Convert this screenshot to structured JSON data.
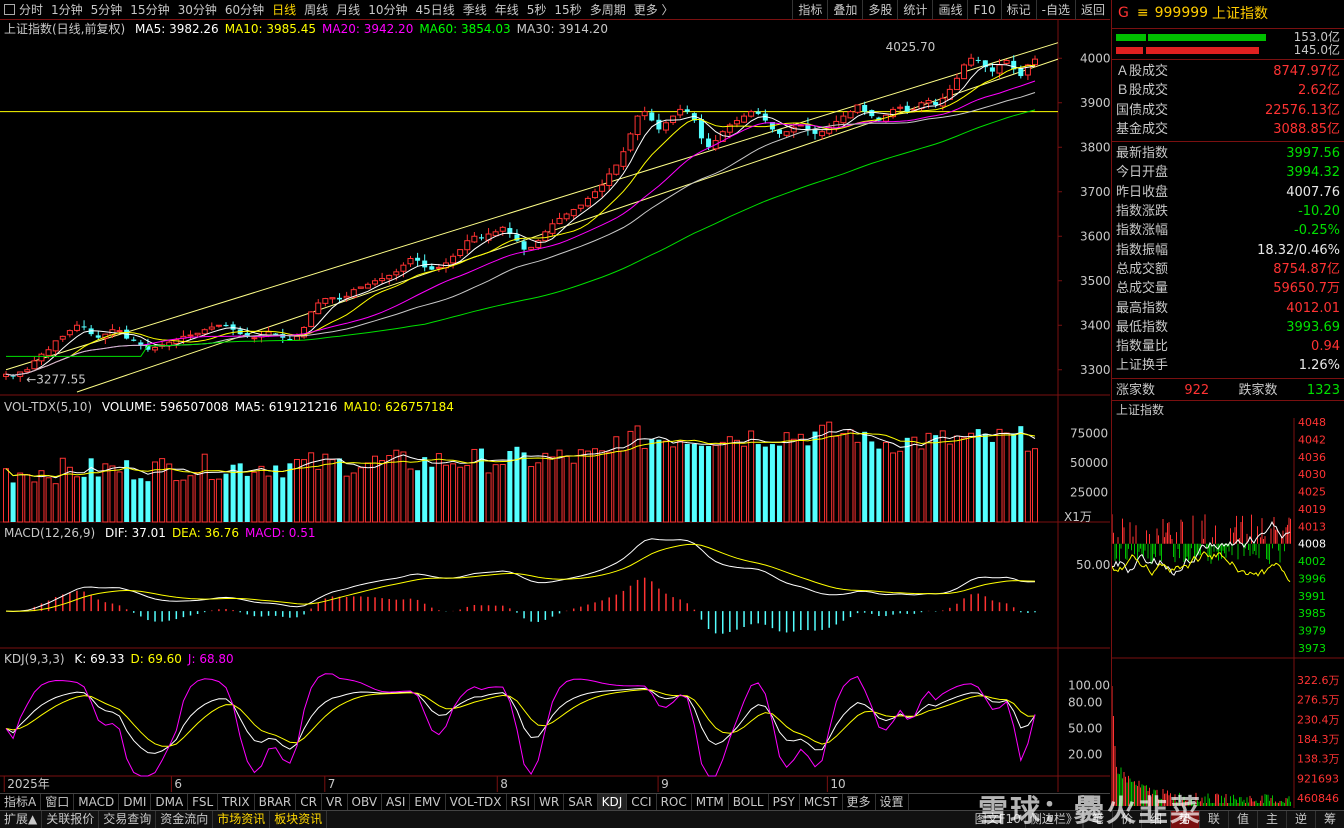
{
  "topbar": {
    "timeframes": [
      "分时",
      "1分钟",
      "5分钟",
      "15分钟",
      "30分钟",
      "60分钟",
      "日线",
      "周线",
      "月线",
      "10分钟",
      "45日线",
      "季线",
      "年线",
      "5秒",
      "15秒",
      "多周期",
      "更多 〉"
    ],
    "active": "日线",
    "buttons": [
      "指标",
      "叠加",
      "多股",
      "统计",
      "画线",
      "F10",
      "标记",
      "-自选",
      "返回"
    ]
  },
  "main": {
    "title": "上证指数(日线,前复权)",
    "ma": [
      {
        "label": "MA5: 3982.26",
        "color": "#ffffff"
      },
      {
        "label": "MA10: 3985.45",
        "color": "#ffff00"
      },
      {
        "label": "MA20: 3942.20",
        "color": "#ff00ff"
      },
      {
        "label": "MA60: 3854.03",
        "color": "#00ff00"
      },
      {
        "label": "MA30: 3914.20",
        "color": "#c8c8c8"
      }
    ],
    "high_label": "4025.70",
    "low_label": "3277.55",
    "y_ticks": [
      3300,
      3400,
      3500,
      3600,
      3700,
      3800,
      3900,
      4000
    ],
    "hline": 3880
  },
  "volume": {
    "title": "VOL-TDX(5,10)",
    "labels": [
      {
        "label": "VOLUME: 596507008",
        "color": "#ffffff"
      },
      {
        "label": "MA5: 619121216",
        "color": "#ffffff"
      },
      {
        "label": "MA10: 626757184",
        "color": "#ffff00"
      }
    ],
    "y_ticks": [
      25000,
      50000,
      75000
    ],
    "unit": "X1万"
  },
  "macd": {
    "title": "MACD(12,26,9)",
    "labels": [
      {
        "label": "DIF: 37.01",
        "color": "#ffffff"
      },
      {
        "label": "DEA: 36.76",
        "color": "#ffff00"
      },
      {
        "label": "MACD: 0.51",
        "color": "#ff00ff"
      }
    ],
    "y_tick": "50.00"
  },
  "kdj": {
    "title": "KDJ(9,3,3)",
    "labels": [
      {
        "label": "K: 69.33",
        "color": "#ffffff"
      },
      {
        "label": "D: 69.60",
        "color": "#ffff00"
      },
      {
        "label": "J: 68.80",
        "color": "#ff00ff"
      }
    ],
    "y_ticks": [
      "100.00",
      "80.00",
      "50.00",
      "20.00"
    ]
  },
  "x_axis": {
    "labels": [
      {
        "text": "2025年",
        "pos": 0.004
      },
      {
        "text": "6",
        "pos": 0.162
      },
      {
        "text": "7",
        "pos": 0.307
      },
      {
        "text": "8",
        "pos": 0.47
      },
      {
        "text": "9",
        "pos": 0.622
      },
      {
        "text": "10",
        "pos": 0.782
      }
    ]
  },
  "tabs": [
    "指标A",
    "窗口",
    "MACD",
    "DMI",
    "DMA",
    "FSL",
    "TRIX",
    "BRAR",
    "CR",
    "VR",
    "OBV",
    "ASI",
    "EMV",
    "VOL-TDX",
    "RSI",
    "WR",
    "SAR",
    "KDJ",
    "CCI",
    "ROC",
    "MTM",
    "BOLL",
    "PSY",
    "MCST",
    "更多",
    "设置"
  ],
  "active_tab": "KDJ",
  "bottom": {
    "left": [
      "扩展▲",
      "关联报价",
      "交易查询",
      "资金流向",
      "市场资讯",
      "板块资讯"
    ],
    "mid": [
      "图文F10",
      "侧边栏》"
    ],
    "right": [
      "笔",
      "价",
      "细",
      "势",
      "联",
      "值",
      "主",
      "逆",
      "筹"
    ],
    "active_right": "势"
  },
  "side": {
    "g": "G",
    "eq": "≡",
    "code": "999999",
    "name": "上证指数",
    "bars": [
      {
        "green_from": 0,
        "green_to": 0.13,
        "green2_from": 0.14,
        "green2_to": 0.66,
        "value": "153.0亿"
      },
      {
        "red_from": 0,
        "red_to": 0.12,
        "red2_from": 0.13,
        "red2_to": 0.63,
        "value": "145.0亿"
      }
    ],
    "turnover": [
      {
        "k": "Ａ股成交",
        "v": "8747.97亿",
        "c": "red"
      },
      {
        "k": "Ｂ股成交",
        "v": "2.62亿",
        "c": "red"
      },
      {
        "k": "国债成交",
        "v": "22576.13亿",
        "c": "red"
      },
      {
        "k": "基金成交",
        "v": "3088.85亿",
        "c": "red"
      }
    ],
    "stats": [
      {
        "k": "最新指数",
        "v": "3997.56",
        "c": "green"
      },
      {
        "k": "今日开盘",
        "v": "3994.32",
        "c": "green"
      },
      {
        "k": "昨日收盘",
        "v": "4007.76",
        "c": "white"
      },
      {
        "k": "指数涨跌",
        "v": "-10.20",
        "c": "green"
      },
      {
        "k": "指数涨幅",
        "v": "-0.25%",
        "c": "green"
      },
      {
        "k": "指数振幅",
        "v": "18.32/0.46%",
        "c": "white"
      },
      {
        "k": "总成交额",
        "v": "8754.87亿",
        "c": "red"
      },
      {
        "k": "总成交量",
        "v": "59650.7万",
        "c": "red"
      },
      {
        "k": "最高指数",
        "v": "4012.01",
        "c": "red"
      },
      {
        "k": "最低指数",
        "v": "3993.69",
        "c": "green"
      },
      {
        "k": "指数量比",
        "v": "0.94",
        "c": "red"
      },
      {
        "k": "上证换手",
        "v": "1.26%",
        "c": "white"
      }
    ],
    "updown": {
      "up_label": "涨家数",
      "up": "922",
      "down_label": "跌家数",
      "down": "1323"
    },
    "mini_title": "上证指数",
    "mini_price_ticks": [
      "4048",
      "4042",
      "4036",
      "4030",
      "4025",
      "4019",
      "4013",
      "4008",
      "4002",
      "3996",
      "3991",
      "3985",
      "3979",
      "3973"
    ],
    "mini_vol_ticks": [
      "322.6万",
      "276.5万",
      "230.4万",
      "184.3万",
      "138.3万",
      "921693",
      "460846"
    ]
  },
  "watermark": "雪球：爨火韭菜",
  "chart_data": {
    "type": "candlestick",
    "title": "上证指数(日线,前复权)",
    "price_range": [
      3277.55,
      4025.7
    ],
    "ylim": [
      3250,
      4050
    ],
    "closes": [
      3290,
      3285,
      3295,
      3300,
      3320,
      3335,
      3345,
      3365,
      3375,
      3388,
      3400,
      3395,
      3380,
      3372,
      3380,
      3390,
      3388,
      3370,
      3365,
      3355,
      3345,
      3350,
      3356,
      3362,
      3368,
      3375,
      3378,
      3382,
      3390,
      3396,
      3400,
      3398,
      3390,
      3380,
      3375,
      3372,
      3378,
      3385,
      3380,
      3372,
      3368,
      3375,
      3395,
      3430,
      3450,
      3460,
      3462,
      3458,
      3465,
      3480,
      3486,
      3492,
      3500,
      3505,
      3512,
      3520,
      3535,
      3550,
      3545,
      3530,
      3525,
      3530,
      3540,
      3555,
      3570,
      3590,
      3600,
      3595,
      3605,
      3610,
      3620,
      3605,
      3590,
      3570,
      3575,
      3590,
      3610,
      3628,
      3640,
      3650,
      3660,
      3670,
      3685,
      3700,
      3715,
      3740,
      3760,
      3790,
      3830,
      3870,
      3880,
      3860,
      3840,
      3855,
      3870,
      3885,
      3880,
      3860,
      3820,
      3800,
      3815,
      3835,
      3850,
      3860,
      3870,
      3880,
      3875,
      3860,
      3840,
      3830,
      3835,
      3845,
      3850,
      3838,
      3830,
      3835,
      3845,
      3858,
      3870,
      3880,
      3895,
      3880,
      3870,
      3860,
      3872,
      3885,
      3890,
      3880,
      3885,
      3900,
      3905,
      3895,
      3910,
      3930,
      3955,
      3985,
      4000,
      3995,
      3980,
      3970,
      3985,
      3995,
      3975,
      3960,
      3985,
      3998
    ],
    "volume_unit": "万",
    "volume_ticks": [
      25000,
      50000,
      75000
    ]
  }
}
